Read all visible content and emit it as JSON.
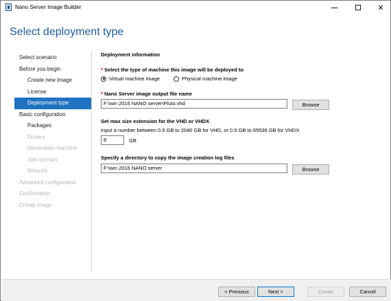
{
  "window": {
    "title": "Nano Server Image Builder"
  },
  "page": {
    "title": "Select deployment type"
  },
  "nav": {
    "items": [
      {
        "label": "Select scenario"
      },
      {
        "label": "Before you begin"
      },
      {
        "label": "Create new image"
      },
      {
        "label": "License"
      },
      {
        "label": "Deployment type"
      },
      {
        "label": "Basic configuration"
      },
      {
        "label": "Packages"
      },
      {
        "label": "Drivers"
      },
      {
        "label": "Destination machine"
      },
      {
        "label": "Join domain"
      },
      {
        "label": "Network"
      },
      {
        "label": "Advanced configuration"
      },
      {
        "label": "Confirmation"
      },
      {
        "label": "Create image"
      }
    ]
  },
  "content": {
    "deployment_heading": "Deployment information",
    "machine_type": {
      "required_mark": "*",
      "label": "Select the type of machine this image will be deployed to",
      "option_virtual": "Virtual machine image",
      "option_physical": "Physical machine image"
    },
    "output_file": {
      "required_mark": "*",
      "label": "Nano Server image output file name",
      "value": "F:\\win 2016 NANO server\\Pluto.vhd",
      "browse_label": "Browse"
    },
    "max_size": {
      "heading": "Set max size extension for the VHD or VHDX",
      "description": "Input a number between 0.5 GB to 2040 GB for VHD, or 0.5 GB to 65536 GB for VHDX",
      "value": "8",
      "unit": "GB"
    },
    "log_dir": {
      "heading": "Specify a directory to copy the image creation log files",
      "value": "F:\\win 2016 NANO server",
      "browse_label": "Browse"
    }
  },
  "footer": {
    "previous_label": "< Previous",
    "next_label": "Next >",
    "create_label": "Create",
    "cancel_label": "Cancel"
  }
}
